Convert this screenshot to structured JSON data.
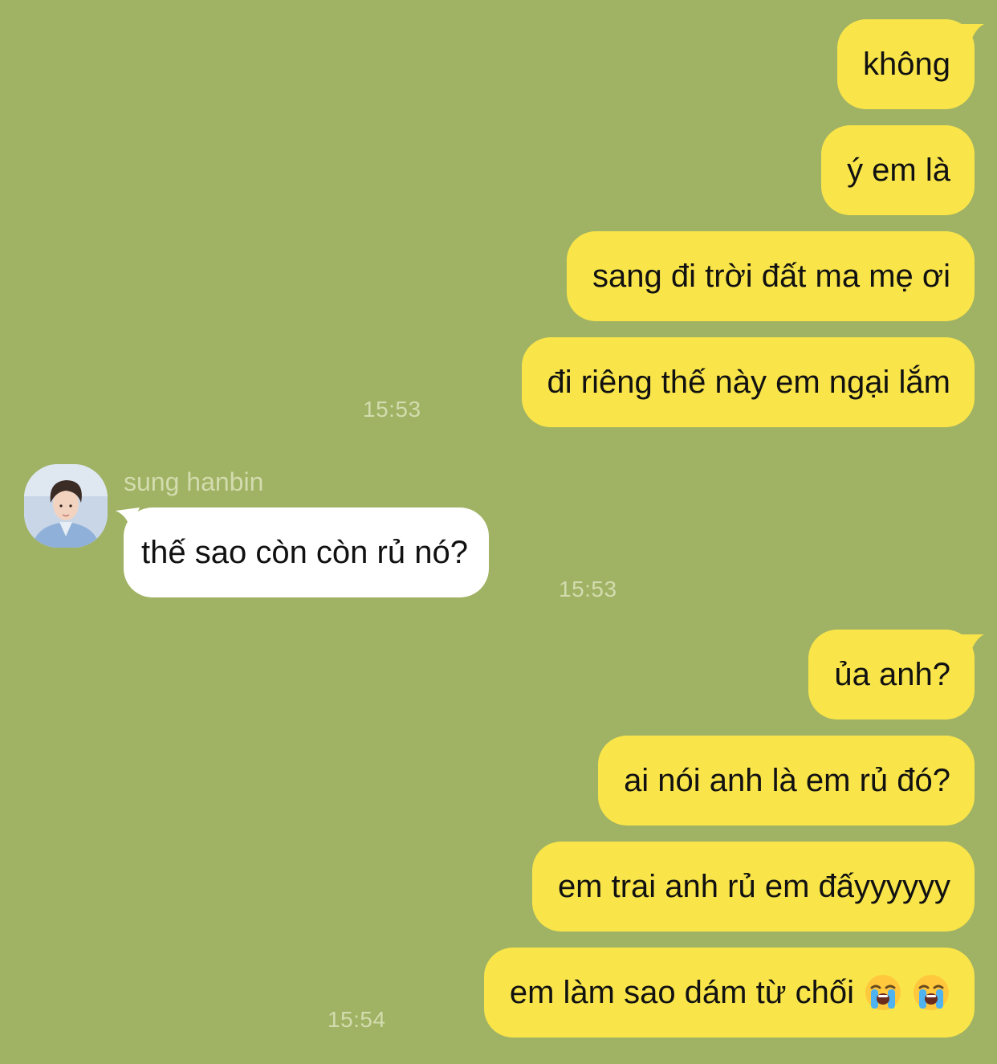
{
  "contact": {
    "name": "sung hanbin"
  },
  "messages": [
    {
      "side": "out",
      "text": "không"
    },
    {
      "side": "out",
      "text": "ý em là"
    },
    {
      "side": "out",
      "text": "sang đi trời đất ma mẹ ơi"
    },
    {
      "side": "out",
      "text": "đi riêng thế này em ngại lắm"
    },
    {
      "side": "in",
      "text": "thế sao còn còn rủ nó?"
    },
    {
      "side": "out",
      "text": "ủa anh?"
    },
    {
      "side": "out",
      "text": "ai nói anh là em rủ đó?"
    },
    {
      "side": "out",
      "text": "em trai anh rủ em đấyyyyyy"
    },
    {
      "side": "out",
      "text": "em làm sao dám từ chối",
      "emojis": [
        "loudly-crying-face",
        "loudly-crying-face"
      ]
    }
  ],
  "timestamps": {
    "group1": "15:53",
    "incoming": "15:53",
    "group2": "15:54"
  },
  "colors": {
    "background": "#a0b263",
    "outgoing_bubble": "#f9e54a",
    "incoming_bubble": "#ffffff",
    "meta_text": "#d3dcae"
  }
}
